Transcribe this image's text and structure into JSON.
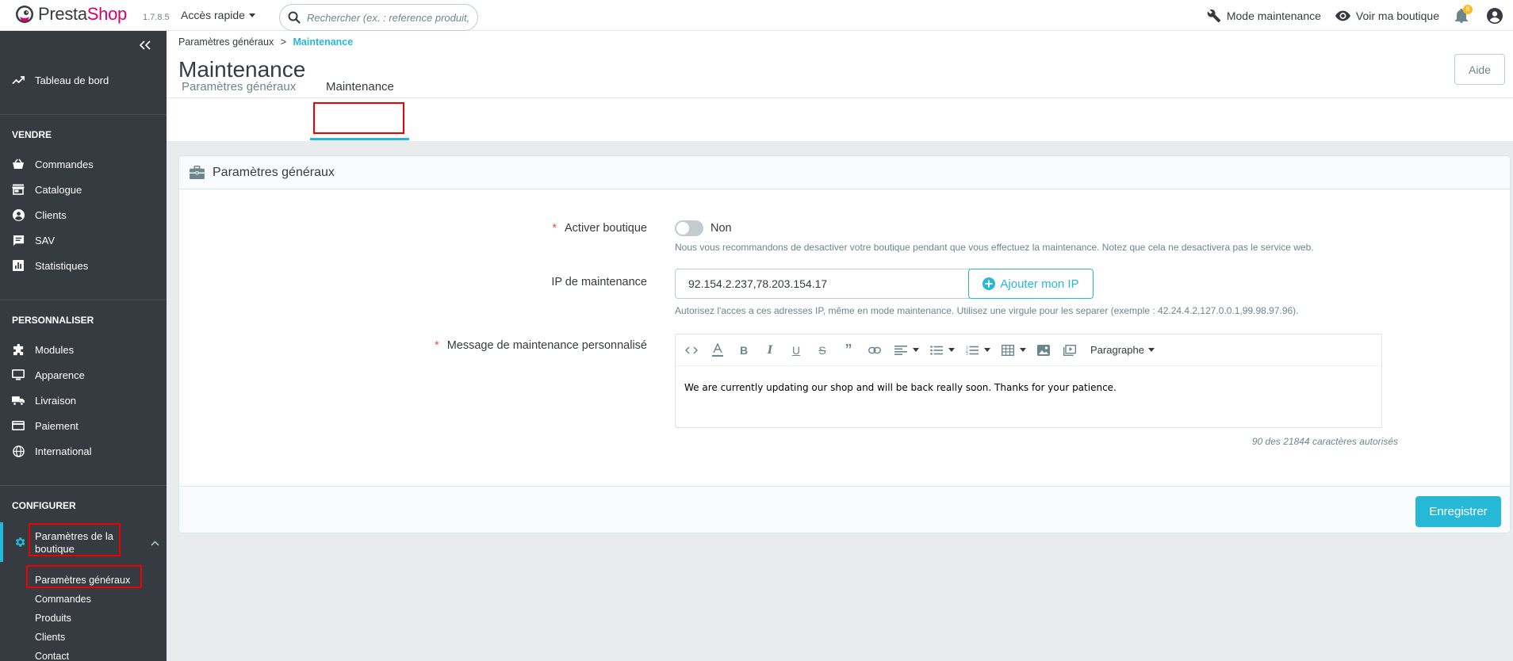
{
  "header": {
    "logo_part1": "Presta",
    "logo_part2": "Shop",
    "version": "1.7.8.5",
    "quick_access": "Accès rapide",
    "search_placeholder": "Rechercher (ex. : reference produit, no",
    "maintenance_mode": "Mode maintenance",
    "view_shop": "Voir ma boutique",
    "notifications_count": "8"
  },
  "sidebar": {
    "dashboard": "Tableau de bord",
    "sections": {
      "sell": "VENDRE",
      "customize": "PERSONNALISER",
      "configure": "CONFIGURER"
    },
    "sell_items": [
      "Commandes",
      "Catalogue",
      "Clients",
      "SAV",
      "Statistiques"
    ],
    "customize_items": [
      "Modules",
      "Apparence",
      "Livraison",
      "Paiement",
      "International"
    ],
    "active_item": "Paramètres de la boutique",
    "sub_items": [
      "Paramètres généraux",
      "Commandes",
      "Produits",
      "Clients",
      "Contact"
    ]
  },
  "breadcrumb": {
    "parent": "Paramètres généraux",
    "separator": ">",
    "current": "Maintenance"
  },
  "page_title": "Maintenance",
  "help_button": "Aide",
  "tabs": [
    "Paramètres généraux",
    "Maintenance"
  ],
  "card": {
    "title": "Paramètres généraux",
    "shop_enable_label": "Activer boutique",
    "shop_enable_value": "Non",
    "shop_enable_help": "Nous vous recommandons de desactiver votre boutique pendant que vous effectuez la maintenance. Notez que cela ne desactivera pas le service web.",
    "ip_label": "IP de maintenance",
    "ip_value": "92.154.2.237,78.203.154.17",
    "add_ip_button": "Ajouter mon IP",
    "ip_help": "Autorisez l'acces a ces adresses IP, même en mode maintenance. Utilisez une virgule pour les separer (exemple : 42.24.4.2,127.0.0.1,99.98.97.96).",
    "message_label": "Message de maintenance personnalisé",
    "editor_format": "Paragraphe",
    "message_content": "We are currently updating our shop and will be back really soon. Thanks for your patience.",
    "char_counter": "90 des 21844 caractères autorisés",
    "save_button": "Enregistrer"
  },
  "colors": {
    "accent": "#25b9d7",
    "sidebar_bg": "#363a41",
    "brand_pink": "#df0067",
    "required": "#f54c3e",
    "highlight_box": "#e00000"
  }
}
